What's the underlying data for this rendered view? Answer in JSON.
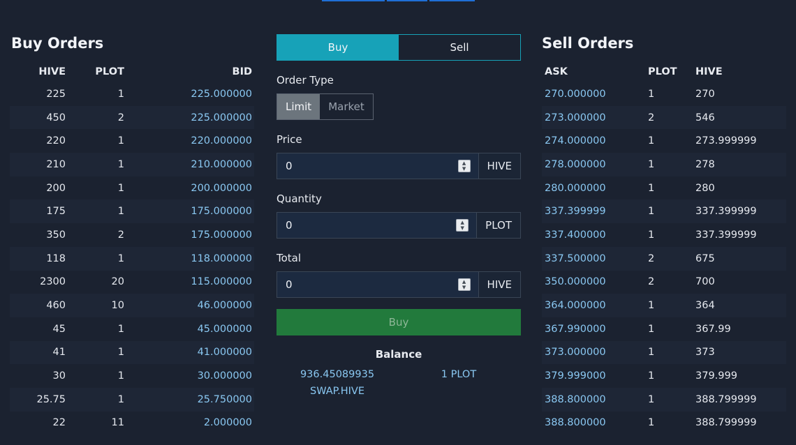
{
  "buy_orders": {
    "title": "Buy Orders",
    "headers": [
      "HIVE",
      "PLOT",
      "BID"
    ],
    "rows": [
      [
        "225",
        "1",
        "225.000000"
      ],
      [
        "450",
        "2",
        "225.000000"
      ],
      [
        "220",
        "1",
        "220.000000"
      ],
      [
        "210",
        "1",
        "210.000000"
      ],
      [
        "200",
        "1",
        "200.000000"
      ],
      [
        "175",
        "1",
        "175.000000"
      ],
      [
        "350",
        "2",
        "175.000000"
      ],
      [
        "118",
        "1",
        "118.000000"
      ],
      [
        "2300",
        "20",
        "115.000000"
      ],
      [
        "460",
        "10",
        "46.000000"
      ],
      [
        "45",
        "1",
        "45.000000"
      ],
      [
        "41",
        "1",
        "41.000000"
      ],
      [
        "30",
        "1",
        "30.000000"
      ],
      [
        "25.75",
        "1",
        "25.750000"
      ],
      [
        "22",
        "11",
        "2.000000"
      ]
    ]
  },
  "sell_orders": {
    "title": "Sell Orders",
    "headers": [
      "ASK",
      "PLOT",
      "HIVE"
    ],
    "rows": [
      [
        "270.000000",
        "1",
        "270"
      ],
      [
        "273.000000",
        "2",
        "546"
      ],
      [
        "274.000000",
        "1",
        "273.999999"
      ],
      [
        "278.000000",
        "1",
        "278"
      ],
      [
        "280.000000",
        "1",
        "280"
      ],
      [
        "337.399999",
        "1",
        "337.399999"
      ],
      [
        "337.400000",
        "1",
        "337.399999"
      ],
      [
        "337.500000",
        "2",
        "675"
      ],
      [
        "350.000000",
        "2",
        "700"
      ],
      [
        "364.000000",
        "1",
        "364"
      ],
      [
        "367.990000",
        "1",
        "367.99"
      ],
      [
        "373.000000",
        "1",
        "373"
      ],
      [
        "379.999000",
        "1",
        "379.999"
      ],
      [
        "388.800000",
        "1",
        "388.799999"
      ],
      [
        "388.800000",
        "1",
        "388.799999"
      ]
    ]
  },
  "form": {
    "side_buy": "Buy",
    "side_sell": "Sell",
    "order_type_label": "Order Type",
    "type_limit": "Limit",
    "type_market": "Market",
    "price_label": "Price",
    "price_value": "0",
    "price_unit": "HIVE",
    "quantity_label": "Quantity",
    "quantity_value": "0",
    "quantity_unit": "PLOT",
    "total_label": "Total",
    "total_value": "0",
    "total_unit": "HIVE",
    "submit_label": "Buy"
  },
  "balance": {
    "title": "Balance",
    "hive_amount": "936.45089935",
    "hive_symbol": "SWAP.HIVE",
    "plot_amount": "1 PLOT"
  },
  "colors": {
    "background": "#1b2230",
    "accent": "#17a2b8",
    "price_link": "#8ac8f2",
    "buy_button": "#227a3c"
  }
}
